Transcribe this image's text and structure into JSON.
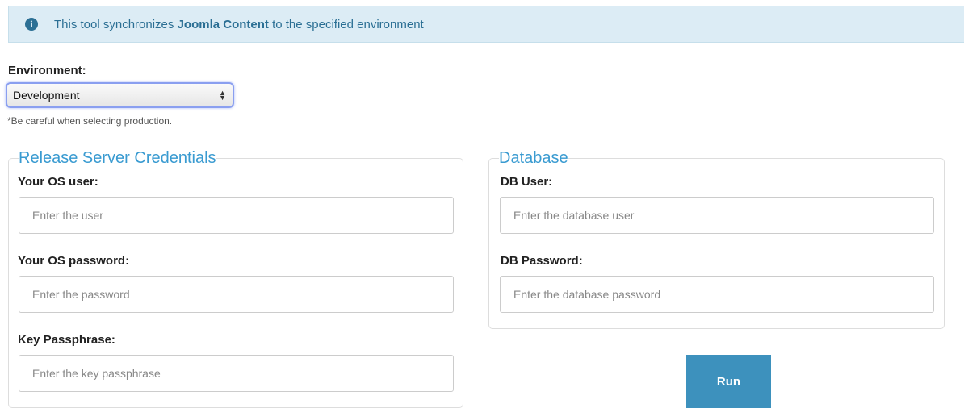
{
  "alert": {
    "icon": "info-circle-icon",
    "text_before": "This tool synchronizes ",
    "text_bold": "Joomla Content",
    "text_after": " to the specified environment"
  },
  "environment": {
    "label": "Environment:",
    "selected": "Development",
    "hint": "*Be careful when selecting production."
  },
  "release": {
    "legend": "Release Server Credentials",
    "os_user_label": "Your OS user:",
    "os_user_placeholder": "Enter the user",
    "os_password_label": "Your OS password:",
    "os_password_placeholder": "Enter the password",
    "passphrase_label": "Key Passphrase:",
    "passphrase_placeholder": "Enter the key passphrase"
  },
  "database": {
    "legend": "Database",
    "user_label": "DB User:",
    "user_placeholder": "Enter the database user",
    "password_label": "DB Password:",
    "password_placeholder": "Enter the database password"
  },
  "actions": {
    "run_label": "Run"
  },
  "colors": {
    "alert_bg": "#dcecf5",
    "alert_text": "#2b6f94",
    "legend": "#3a9bd1",
    "button": "#3d91bd"
  }
}
